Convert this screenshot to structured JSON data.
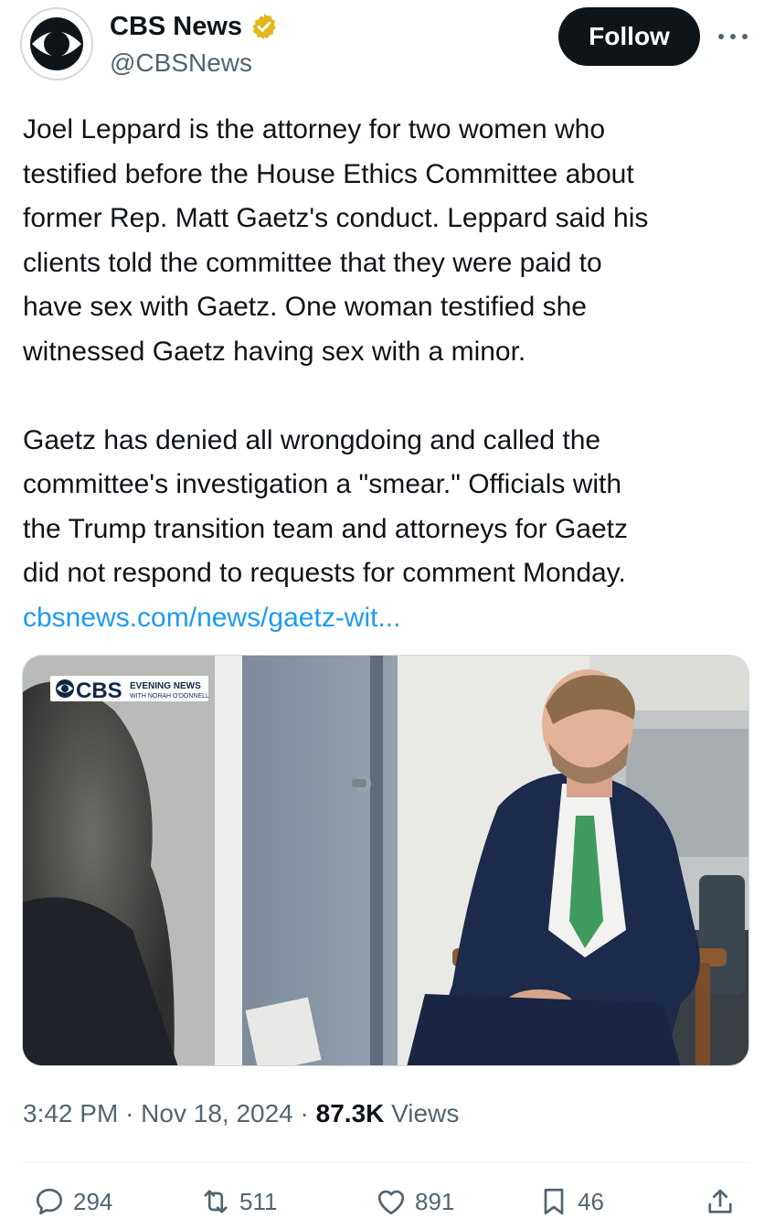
{
  "author": {
    "display_name": "CBS News",
    "handle": "@CBSNews",
    "verified_badge_icon": "gold-verified-badge-icon",
    "badge_color": "#e2b719"
  },
  "follow_button": {
    "label": "Follow"
  },
  "more_button": {
    "label": "···"
  },
  "tweet": {
    "paragraph1": [
      "Joel Leppard is the attorney for two women who",
      "testified before the House Ethics Committee about",
      "former Rep. Matt Gaetz's conduct. Leppard said his",
      "clients told the committee that they were paid to",
      "have sex with Gaetz. One woman testified she",
      "witnessed Gaetz having sex with a minor."
    ],
    "paragraph2": [
      "Gaetz has denied all wrongdoing and called the",
      "committee's investigation a \"smear.\" Officials with",
      "the Trump transition team and attorneys for Gaetz",
      "did not respond to requests for comment Monday."
    ],
    "link": "cbsnews.com/news/gaetz-wit...",
    "link_color": "#1d9bf0"
  },
  "media": {
    "overlay_brand": "CBS",
    "overlay_line1": "EVENING NEWS",
    "overlay_line2": "WITH NORAH O'DONNELL"
  },
  "meta": {
    "time": "3:42 PM",
    "separator": "·",
    "date": "Nov 18, 2024",
    "views_count": "87.3K",
    "views_label": "Views"
  },
  "actions": {
    "replies": "294",
    "reposts": "511",
    "likes": "891",
    "bookmarks": "46"
  }
}
